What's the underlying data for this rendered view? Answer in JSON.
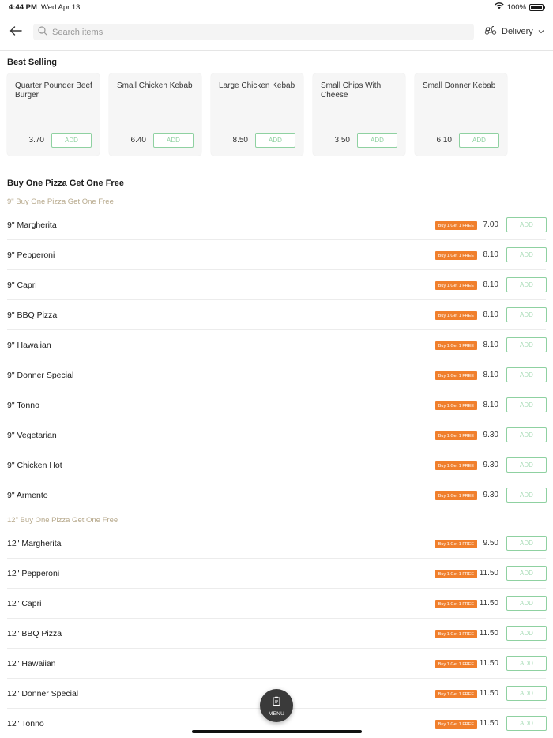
{
  "status_bar": {
    "time": "4:44 PM",
    "date": "Wed Apr 13",
    "battery": "100%"
  },
  "header": {
    "search_placeholder": "Search items",
    "delivery_label": "Delivery"
  },
  "best_selling": {
    "title": "Best Selling",
    "items": [
      {
        "name": "Quarter Pounder Beef Burger",
        "price": "3.70",
        "add": "ADD"
      },
      {
        "name": "Small Chicken Kebab",
        "price": "6.40",
        "add": "ADD"
      },
      {
        "name": "Large Chicken Kebab",
        "price": "8.50",
        "add": "ADD"
      },
      {
        "name": "Small Chips With Cheese",
        "price": "3.50",
        "add": "ADD"
      },
      {
        "name": "Small Donner Kebab",
        "price": "6.10",
        "add": "ADD"
      }
    ]
  },
  "section": {
    "title": "Buy One Pizza Get One Free",
    "promo_label": "Buy 1 Get 1 FREE",
    "add_label": "ADD",
    "categories": [
      {
        "title": "9\" Buy One Pizza Get One Free",
        "items": [
          {
            "name": "9\" Margherita",
            "price": "7.00"
          },
          {
            "name": "9\" Pepperoni",
            "price": "8.10"
          },
          {
            "name": "9\" Capri",
            "price": "8.10"
          },
          {
            "name": "9\" BBQ Pizza",
            "price": "8.10"
          },
          {
            "name": "9\" Hawaiian",
            "price": "8.10"
          },
          {
            "name": "9\" Donner Special",
            "price": "8.10"
          },
          {
            "name": "9\" Tonno",
            "price": "8.10"
          },
          {
            "name": "9\" Vegetarian",
            "price": "9.30"
          },
          {
            "name": "9\" Chicken Hot",
            "price": "9.30"
          },
          {
            "name": "9\" Armento",
            "price": "9.30"
          }
        ]
      },
      {
        "title": "12\" Buy One Pizza Get One Free",
        "items": [
          {
            "name": "12\" Margherita",
            "price": "9.50"
          },
          {
            "name": "12\" Pepperoni",
            "price": "11.50"
          },
          {
            "name": "12\" Capri",
            "price": "11.50"
          },
          {
            "name": "12\" BBQ Pizza",
            "price": "11.50"
          },
          {
            "name": "12\" Hawaiian",
            "price": "11.50"
          },
          {
            "name": "12\" Donner Special",
            "price": "11.50"
          },
          {
            "name": "12\" Tonno",
            "price": "11.50"
          }
        ]
      }
    ]
  },
  "fab": {
    "label": "MENU"
  },
  "colors": {
    "accent_green": "#8fd1a1",
    "promo_orange": "#f07f2c",
    "category_tan": "#b7a98c",
    "fab_dark": "#3a3a3a"
  },
  "icons": [
    "wifi-icon",
    "battery-icon",
    "back-arrow-icon",
    "search-icon",
    "scooter-icon",
    "chevron-down-icon",
    "clipboard-icon"
  ]
}
